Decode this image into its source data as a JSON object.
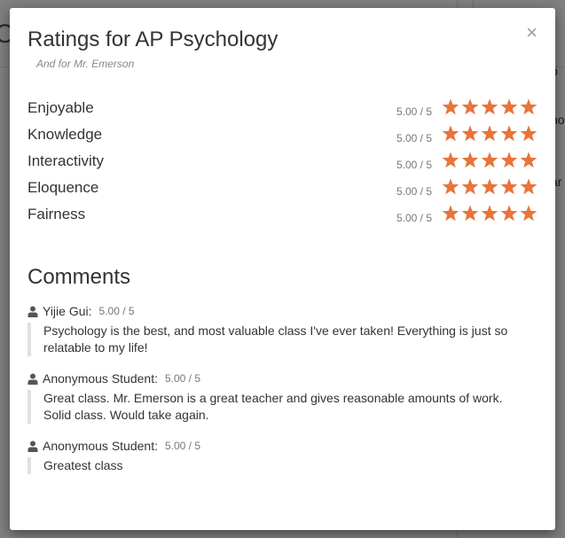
{
  "background": {
    "left_fragment": "C",
    "right_fragments": [
      "o",
      "ho",
      "ar"
    ]
  },
  "modal": {
    "title": "Ratings for AP Psychology",
    "subtitle": "And for Mr. Emerson",
    "close_label": "×",
    "star_color": "#e8743b",
    "ratings": [
      {
        "label": "Enjoyable",
        "value_text": "5.00 / 5",
        "stars": 5
      },
      {
        "label": "Knowledge",
        "value_text": "5.00 / 5",
        "stars": 5
      },
      {
        "label": "Interactivity",
        "value_text": "5.00 / 5",
        "stars": 5
      },
      {
        "label": "Eloquence",
        "value_text": "5.00 / 5",
        "stars": 5
      },
      {
        "label": "Fairness",
        "value_text": "5.00 / 5",
        "stars": 5
      }
    ],
    "comments_heading": "Comments",
    "comments": [
      {
        "author": "Yijie Gui:",
        "rating_text": "5.00 / 5",
        "text": "Psychology is the best, and most valuable class I've ever taken! Everything is just so relatable to my life!"
      },
      {
        "author": "Anonymous Student:",
        "rating_text": "5.00 / 5",
        "text": "Great class. Mr. Emerson is a great teacher and gives reasonable amounts of work. Solid class. Would take again."
      },
      {
        "author": "Anonymous Student:",
        "rating_text": "5.00 / 5",
        "text": "Greatest class"
      }
    ]
  }
}
